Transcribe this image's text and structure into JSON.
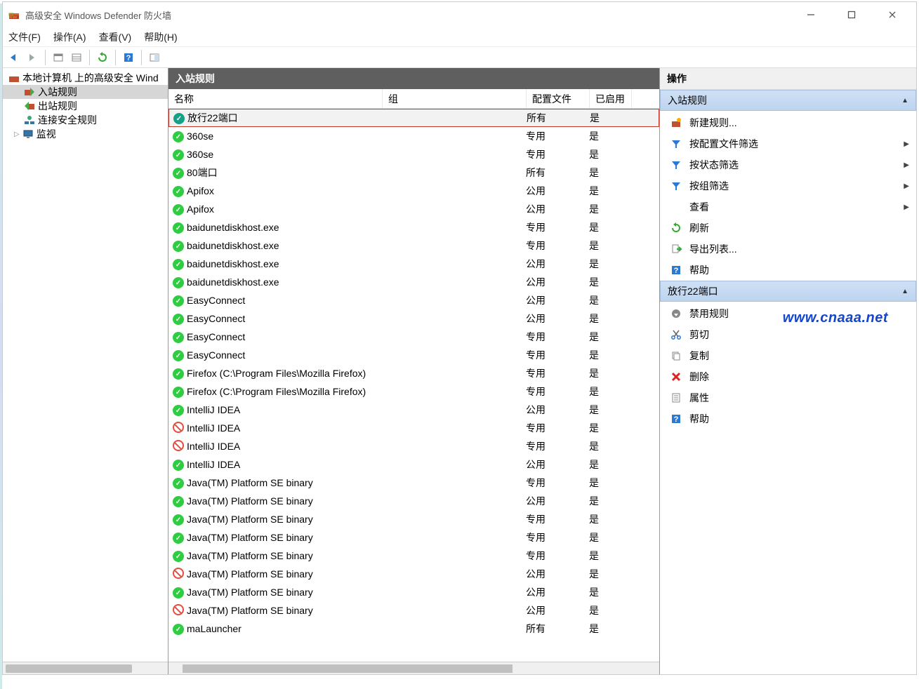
{
  "window": {
    "title": "高级安全 Windows Defender 防火墙"
  },
  "menu": {
    "file": "文件(F)",
    "action": "操作(A)",
    "view": "查看(V)",
    "help": "帮助(H)"
  },
  "tree": {
    "root": "本地计算机 上的高级安全 Wind",
    "inbound": "入站规则",
    "outbound": "出站规则",
    "connsec": "连接安全规则",
    "monitor": "监视"
  },
  "listTitle": "入站规则",
  "columns": {
    "name": "名称",
    "group": "组",
    "profile": "配置文件",
    "enabled": "已启用"
  },
  "rules": [
    {
      "icon": "custom",
      "name": "放行22端口",
      "group": "",
      "profile": "所有",
      "enabled": "是",
      "selected": true
    },
    {
      "icon": "allow",
      "name": "360se",
      "group": "",
      "profile": "专用",
      "enabled": "是"
    },
    {
      "icon": "allow",
      "name": "360se",
      "group": "",
      "profile": "专用",
      "enabled": "是"
    },
    {
      "icon": "allow",
      "name": "80端口",
      "group": "",
      "profile": "所有",
      "enabled": "是"
    },
    {
      "icon": "allow",
      "name": "Apifox",
      "group": "",
      "profile": "公用",
      "enabled": "是"
    },
    {
      "icon": "allow",
      "name": "Apifox",
      "group": "",
      "profile": "公用",
      "enabled": "是"
    },
    {
      "icon": "allow",
      "name": "baidunetdiskhost.exe",
      "group": "",
      "profile": "专用",
      "enabled": "是"
    },
    {
      "icon": "allow",
      "name": "baidunetdiskhost.exe",
      "group": "",
      "profile": "专用",
      "enabled": "是"
    },
    {
      "icon": "allow",
      "name": "baidunetdiskhost.exe",
      "group": "",
      "profile": "公用",
      "enabled": "是"
    },
    {
      "icon": "allow",
      "name": "baidunetdiskhost.exe",
      "group": "",
      "profile": "公用",
      "enabled": "是"
    },
    {
      "icon": "allow",
      "name": "EasyConnect",
      "group": "",
      "profile": "公用",
      "enabled": "是"
    },
    {
      "icon": "allow",
      "name": "EasyConnect",
      "group": "",
      "profile": "公用",
      "enabled": "是"
    },
    {
      "icon": "allow",
      "name": "EasyConnect",
      "group": "",
      "profile": "专用",
      "enabled": "是"
    },
    {
      "icon": "allow",
      "name": "EasyConnect",
      "group": "",
      "profile": "专用",
      "enabled": "是"
    },
    {
      "icon": "allow",
      "name": "Firefox (C:\\Program Files\\Mozilla Firefox)",
      "group": "",
      "profile": "专用",
      "enabled": "是"
    },
    {
      "icon": "allow",
      "name": "Firefox (C:\\Program Files\\Mozilla Firefox)",
      "group": "",
      "profile": "专用",
      "enabled": "是"
    },
    {
      "icon": "allow",
      "name": "IntelliJ IDEA",
      "group": "",
      "profile": "公用",
      "enabled": "是"
    },
    {
      "icon": "block",
      "name": "IntelliJ IDEA",
      "group": "",
      "profile": "专用",
      "enabled": "是"
    },
    {
      "icon": "block",
      "name": "IntelliJ IDEA",
      "group": "",
      "profile": "专用",
      "enabled": "是"
    },
    {
      "icon": "allow",
      "name": "IntelliJ IDEA",
      "group": "",
      "profile": "公用",
      "enabled": "是"
    },
    {
      "icon": "allow",
      "name": "Java(TM) Platform SE binary",
      "group": "",
      "profile": "专用",
      "enabled": "是"
    },
    {
      "icon": "allow",
      "name": "Java(TM) Platform SE binary",
      "group": "",
      "profile": "公用",
      "enabled": "是"
    },
    {
      "icon": "allow",
      "name": "Java(TM) Platform SE binary",
      "group": "",
      "profile": "专用",
      "enabled": "是"
    },
    {
      "icon": "allow",
      "name": "Java(TM) Platform SE binary",
      "group": "",
      "profile": "专用",
      "enabled": "是"
    },
    {
      "icon": "allow",
      "name": "Java(TM) Platform SE binary",
      "group": "",
      "profile": "专用",
      "enabled": "是"
    },
    {
      "icon": "block",
      "name": "Java(TM) Platform SE binary",
      "group": "",
      "profile": "公用",
      "enabled": "是"
    },
    {
      "icon": "allow",
      "name": "Java(TM) Platform SE binary",
      "group": "",
      "profile": "公用",
      "enabled": "是"
    },
    {
      "icon": "block",
      "name": "Java(TM) Platform SE binary",
      "group": "",
      "profile": "公用",
      "enabled": "是"
    },
    {
      "icon": "allow",
      "name": "maLauncher",
      "group": "",
      "profile": "所有",
      "enabled": "是"
    }
  ],
  "actions": {
    "header": "操作",
    "sec1": "入站规则",
    "items1": [
      {
        "icon": "new",
        "label": "新建规则..."
      },
      {
        "icon": "filter",
        "label": "按配置文件筛选",
        "sub": true
      },
      {
        "icon": "filter",
        "label": "按状态筛选",
        "sub": true
      },
      {
        "icon": "filter",
        "label": "按组筛选",
        "sub": true
      },
      {
        "icon": "",
        "label": "查看",
        "sub": true
      },
      {
        "icon": "refresh",
        "label": "刷新"
      },
      {
        "icon": "export",
        "label": "导出列表..."
      },
      {
        "icon": "help",
        "label": "帮助"
      }
    ],
    "sec2": "放行22端口",
    "items2": [
      {
        "icon": "disable",
        "label": "禁用规则"
      },
      {
        "icon": "cut",
        "label": "剪切"
      },
      {
        "icon": "copy",
        "label": "复制"
      },
      {
        "icon": "delete",
        "label": "删除"
      },
      {
        "icon": "props",
        "label": "属性"
      },
      {
        "icon": "help",
        "label": "帮助"
      }
    ]
  },
  "watermark": "www.cnaaa.net"
}
